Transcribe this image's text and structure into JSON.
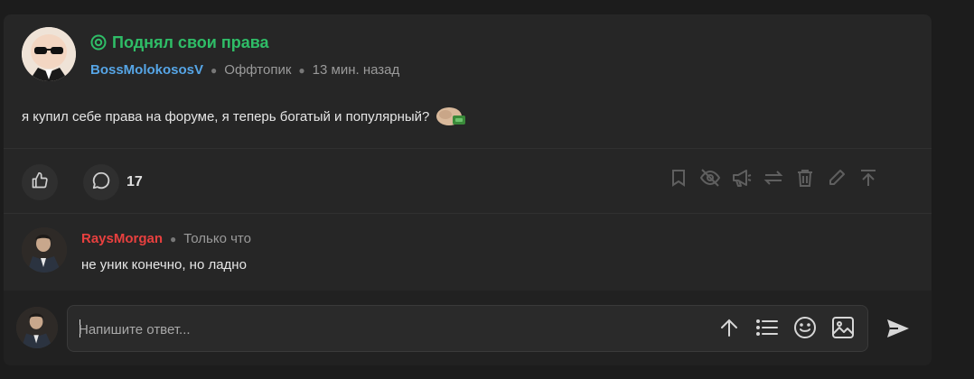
{
  "post": {
    "title": "Поднял свои права",
    "title_icon": "target-icon",
    "author": "BossMolokososV",
    "category": "Оффтопик",
    "time": "13 мин. назад",
    "body": "я купил себе права на форуме, я теперь богатый и популярный?",
    "comment_count": "17",
    "colors": {
      "title": "#2fbd67",
      "author": "#56a5e6"
    }
  },
  "actions": {
    "like_icon": "thumbs-up-icon",
    "comment_icon": "comment-bubble-icon",
    "tools": [
      "bookmark-icon",
      "eye-off-icon",
      "megaphone-icon",
      "repost-icon",
      "trash-icon",
      "pencil-icon",
      "pin-to-top-icon"
    ]
  },
  "comment": {
    "author": "RaysMorgan",
    "time": "Только что",
    "text": "не уник конечно, но ладно",
    "author_color": "#e8403f"
  },
  "reply": {
    "placeholder": "Напишите ответ...",
    "tools": [
      "arrow-up-icon",
      "list-icon",
      "smile-icon",
      "image-icon"
    ],
    "send_icon": "send-icon"
  }
}
